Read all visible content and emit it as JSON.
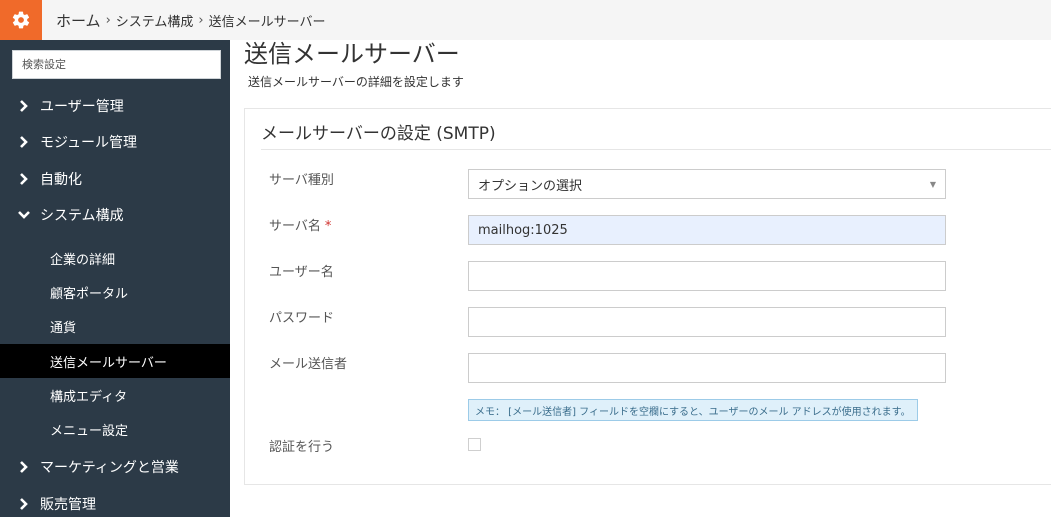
{
  "breadcrumb": {
    "home": "ホーム",
    "section": "システム構成",
    "current": "送信メールサーバー",
    "separator": "›"
  },
  "sidebar": {
    "search_placeholder": "検索設定",
    "items": [
      {
        "label": "ユーザー管理",
        "icon": "chevron-right-icon"
      },
      {
        "label": "モジュール管理",
        "icon": "chevron-right-icon"
      },
      {
        "label": "自動化",
        "icon": "chevron-right-icon"
      },
      {
        "label": "システム構成",
        "icon": "chevron-down-icon",
        "expanded": true
      },
      {
        "label": "マーケティングと営業",
        "icon": "chevron-right-icon"
      },
      {
        "label": "販売管理",
        "icon": "chevron-right-icon"
      }
    ],
    "subitems": [
      {
        "label": "企業の詳細"
      },
      {
        "label": "顧客ポータル"
      },
      {
        "label": "通貨"
      },
      {
        "label": "送信メールサーバー",
        "active": true
      },
      {
        "label": "構成エディタ"
      },
      {
        "label": "メニュー設定"
      }
    ]
  },
  "main": {
    "title": "送信メールサーバー",
    "description": "送信メールサーバーの詳細を設定します",
    "panel_title": "メールサーバーの設定 (SMTP)",
    "fields": {
      "server_type": {
        "label": "サーバ種別",
        "value": "オプションの選択"
      },
      "server_name": {
        "label": "サーバ名",
        "required": "*",
        "value": "mailhog:1025"
      },
      "username": {
        "label": "ユーザー名",
        "value": ""
      },
      "password": {
        "label": "パスワード",
        "value": ""
      },
      "from_email": {
        "label": "メール送信者",
        "value": ""
      },
      "auth": {
        "label": "認証を行う",
        "checked": false
      }
    },
    "note": "メモ： [メール送信者] フィールドを空欄にすると、ユーザーのメール アドレスが使用されます。"
  },
  "colors": {
    "accent": "#f06a2a",
    "sidebar_bg": "#2c3a47",
    "active_bg": "#000000",
    "note_bg": "#dff0fa",
    "filled_input_bg": "#e8f0fe"
  }
}
